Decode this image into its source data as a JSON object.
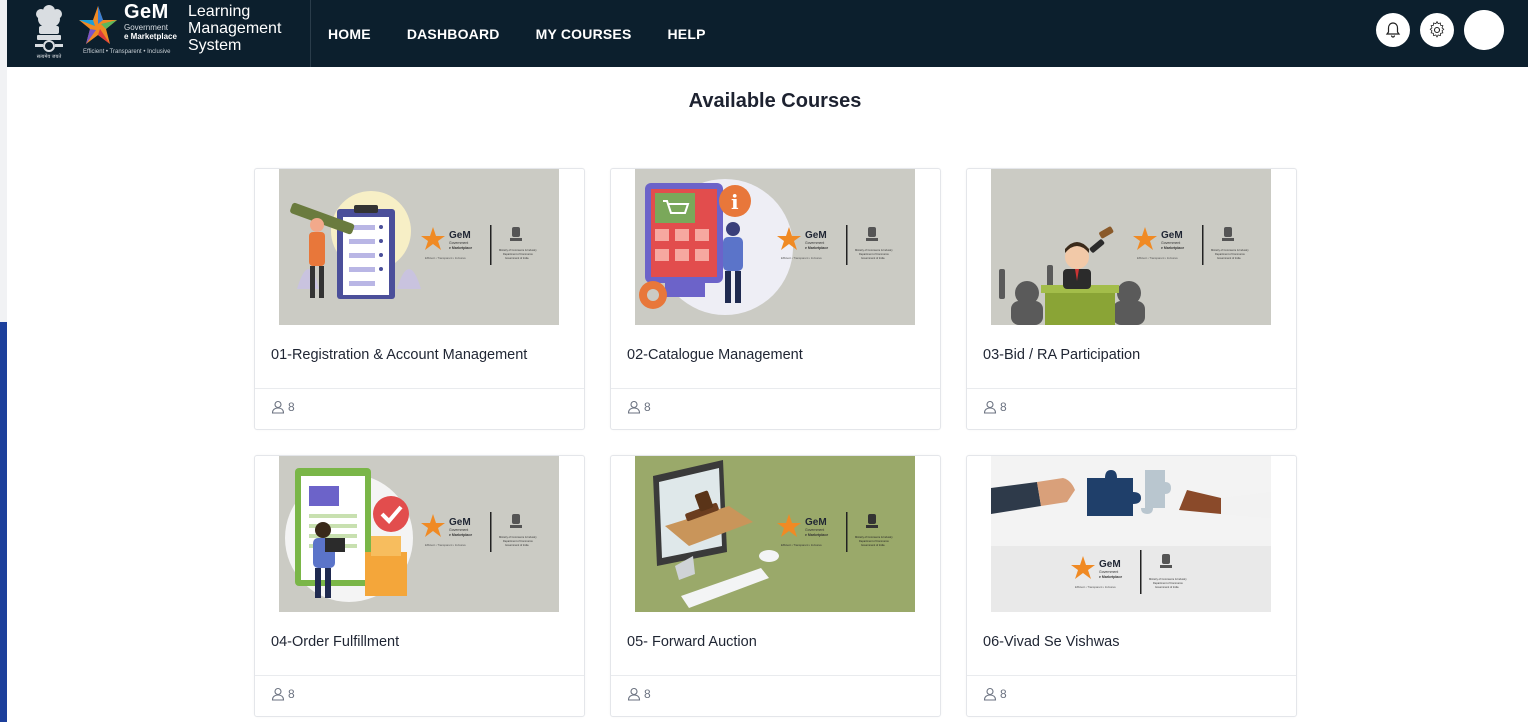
{
  "header": {
    "gem_word": "GeM",
    "gem_sub1": "Government",
    "gem_sub2": "e Marketplace",
    "gem_tagline": "Efficient • Transparent • Inclusive",
    "emblem_caption": "सत्यमेव जयते",
    "lms_title": "Learning\nManagement\nSystem",
    "nav": [
      "HOME",
      "DASHBOARD",
      "MY COURSES",
      "HELP"
    ],
    "icons": [
      "notification-icon",
      "settings-icon",
      "user-avatar"
    ]
  },
  "page": {
    "title": "Available Courses"
  },
  "thumb_brand": {
    "gem": "GeM",
    "line1": "Government",
    "line2": "e Marketplace",
    "tag": "Efficient • Transparent • Inclusive",
    "ministry1": "Ministry of Commerce & Industry",
    "ministry2": "Department of Commerce",
    "ministry3": "Government of India"
  },
  "courses": [
    {
      "name": "01-Registration & Account Management",
      "learners": "8",
      "theme": "registration"
    },
    {
      "name": "02-Catalogue Management",
      "learners": "8",
      "theme": "catalogue"
    },
    {
      "name": "03-Bid / RA Participation",
      "learners": "8",
      "theme": "bid"
    },
    {
      "name": "04-Order Fulfillment",
      "learners": "8",
      "theme": "order"
    },
    {
      "name": "05- Forward Auction",
      "learners": "8",
      "theme": "auction"
    },
    {
      "name": "06-Vivad Se Vishwas",
      "learners": "8",
      "theme": "vivad"
    }
  ],
  "colors": {
    "header_bg": "#0c1f2d",
    "thumb_gray": "#cbcbc4",
    "thumb_green": "#9aa96a",
    "accent_orange": "#e8773a",
    "accent_purple": "#6c63c9"
  }
}
